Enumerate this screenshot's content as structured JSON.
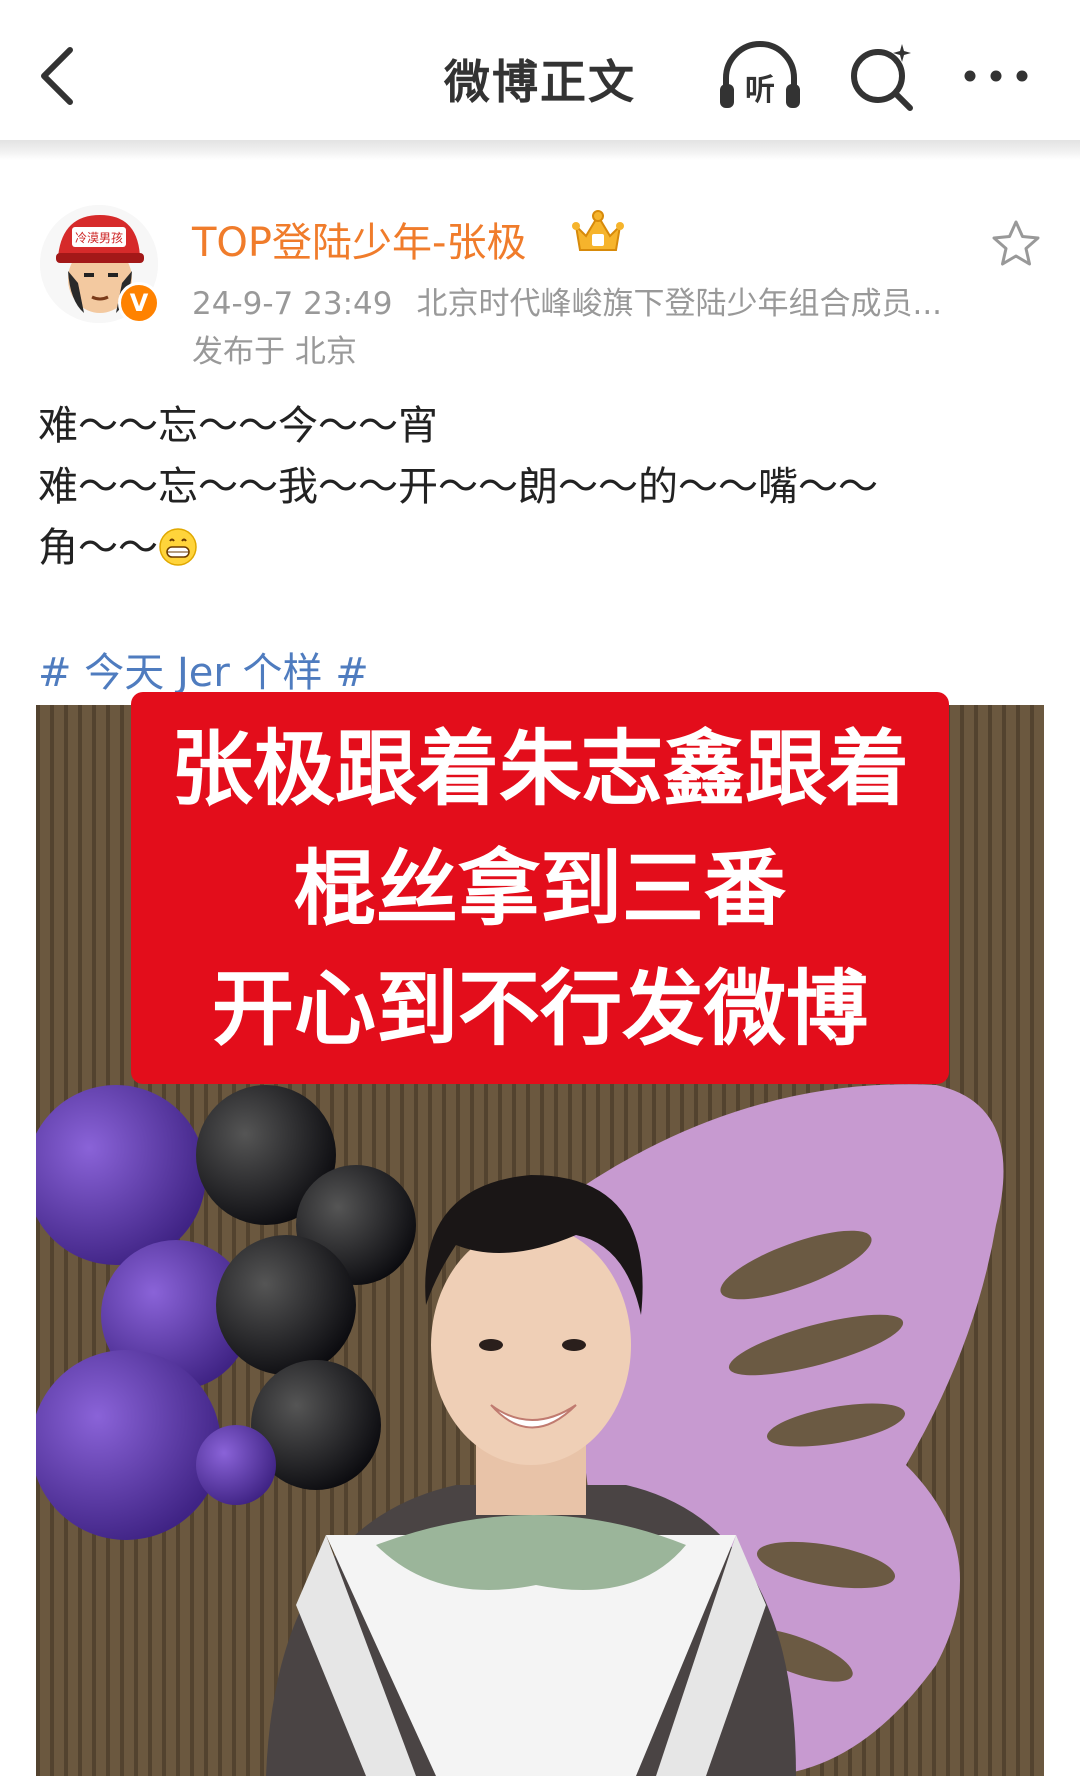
{
  "nav": {
    "title": "微博正文",
    "listen_label": "听"
  },
  "post": {
    "username": "TOP登陆少年-张极",
    "avatar_text": "冷漠男孩",
    "verified_mark": "V",
    "time": "24-9-7 23:49",
    "source": "北京时代峰峻旗下登陆少年组合成员...",
    "location": "发布于 北京",
    "text_lines": [
      "难～～忘～～今～～宵",
      "难～～忘～～我～～开～～朗～～的～～嘴～～",
      "角～～"
    ],
    "hashtag": "# 今天 Jer 个样 #"
  },
  "image": {
    "overlay_lines": [
      "张极跟着朱志鑫跟着",
      "棍丝拿到三番",
      "开心到不行发微博"
    ]
  },
  "colors": {
    "username": "#f07c2b",
    "hashtag": "#4f7cbf",
    "banner": "#e30d1b",
    "verified": "#ff8200"
  }
}
